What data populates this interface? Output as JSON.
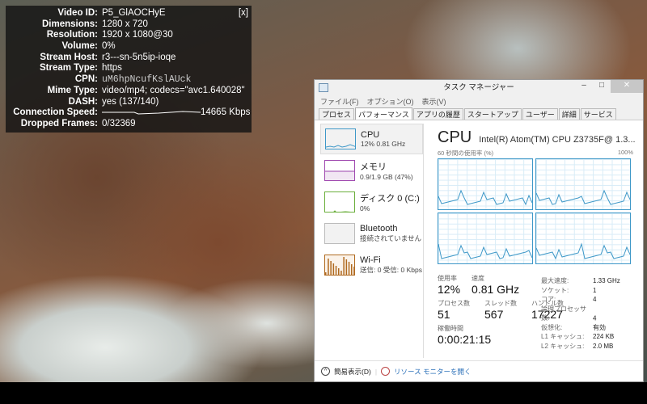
{
  "stats": {
    "close": "[x]",
    "rows": [
      {
        "k": "Video ID:",
        "v": "P5_GlAOCHyE"
      },
      {
        "k": "Dimensions:",
        "v": "1280 x 720"
      },
      {
        "k": "Resolution:",
        "v": "1920 x 1080@30"
      },
      {
        "k": "Volume:",
        "v": "0%"
      },
      {
        "k": "Stream Host:",
        "v": "r3---sn-5n5ip-ioqe"
      },
      {
        "k": "Stream Type:",
        "v": "https"
      },
      {
        "k": "CPN:",
        "v": "uM6hpNcufKslAUck"
      },
      {
        "k": "Mime Type:",
        "v": "video/mp4; codecs=\"avc1.640028\""
      },
      {
        "k": "DASH:",
        "v": "yes (137/140)"
      },
      {
        "k": "Connection Speed:",
        "v": "14665 Kbps"
      },
      {
        "k": "Dropped Frames:",
        "v": "0/32369"
      }
    ]
  },
  "tm": {
    "title": "タスク マネージャー",
    "menu": [
      "ファイル(F)",
      "オプション(O)",
      "表示(V)"
    ],
    "tabs": [
      "プロセス",
      "パフォーマンス",
      "アプリの履歴",
      "スタートアップ",
      "ユーザー",
      "詳細",
      "サービス"
    ],
    "resources": [
      {
        "name": "CPU",
        "sub": "12% 0.81 GHz",
        "color": "#3e98c8"
      },
      {
        "name": "メモリ",
        "sub": "0.9/1.9 GB (47%)",
        "color": "#a04ab0"
      },
      {
        "name": "ディスク 0 (C:)",
        "sub": "0%",
        "color": "#6aae3a"
      },
      {
        "name": "Bluetooth",
        "sub": "接続されていません",
        "color": "#bbbbbb"
      },
      {
        "name": "Wi-Fi",
        "sub": "送信: 0 受信: 0 Kbps",
        "color": "#b06a20"
      }
    ],
    "cpu_title": "CPU",
    "cpu_model": "Intel(R) Atom(TM) CPU Z3735F@ 1.3...",
    "axis_label": "60 秒間の使用率 (%)",
    "axis_max": "100%",
    "usage_label": "使用率",
    "usage": "12%",
    "speed_label": "速度",
    "speed": "0.81 GHz",
    "proc_label": "プロセス数",
    "proc": "51",
    "thread_label": "スレッド数",
    "thread": "567",
    "handle_label": "ハンドル数",
    "handle": "17227",
    "uptime_label": "稼働時間",
    "uptime": "0:00:21:15",
    "specs": [
      {
        "k": "最大速度:",
        "v": "1.33 GHz"
      },
      {
        "k": "ソケット:",
        "v": "1"
      },
      {
        "k": "コア:",
        "v": "4"
      },
      {
        "k": "論理プロセッサ数:",
        "v": "4"
      },
      {
        "k": "仮想化:",
        "v": "有効"
      },
      {
        "k": "L1 キャッシュ:",
        "v": "224 KB"
      },
      {
        "k": "L2 キャッシュ:",
        "v": "2.0 MB"
      }
    ],
    "fewer_details": "簡易表示(D)",
    "resource_monitor": "リソース モニターを開く"
  }
}
